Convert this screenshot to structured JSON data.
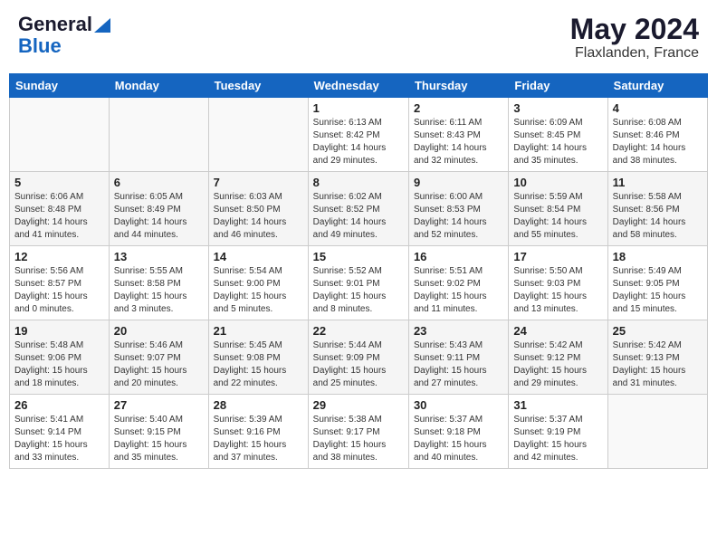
{
  "header": {
    "logo_general": "General",
    "logo_blue": "Blue",
    "month_year": "May 2024",
    "location": "Flaxlanden, France"
  },
  "weekdays": [
    "Sunday",
    "Monday",
    "Tuesday",
    "Wednesday",
    "Thursday",
    "Friday",
    "Saturday"
  ],
  "weeks": [
    [
      {
        "day": "",
        "info": ""
      },
      {
        "day": "",
        "info": ""
      },
      {
        "day": "",
        "info": ""
      },
      {
        "day": "1",
        "info": "Sunrise: 6:13 AM\nSunset: 8:42 PM\nDaylight: 14 hours\nand 29 minutes."
      },
      {
        "day": "2",
        "info": "Sunrise: 6:11 AM\nSunset: 8:43 PM\nDaylight: 14 hours\nand 32 minutes."
      },
      {
        "day": "3",
        "info": "Sunrise: 6:09 AM\nSunset: 8:45 PM\nDaylight: 14 hours\nand 35 minutes."
      },
      {
        "day": "4",
        "info": "Sunrise: 6:08 AM\nSunset: 8:46 PM\nDaylight: 14 hours\nand 38 minutes."
      }
    ],
    [
      {
        "day": "5",
        "info": "Sunrise: 6:06 AM\nSunset: 8:48 PM\nDaylight: 14 hours\nand 41 minutes."
      },
      {
        "day": "6",
        "info": "Sunrise: 6:05 AM\nSunset: 8:49 PM\nDaylight: 14 hours\nand 44 minutes."
      },
      {
        "day": "7",
        "info": "Sunrise: 6:03 AM\nSunset: 8:50 PM\nDaylight: 14 hours\nand 46 minutes."
      },
      {
        "day": "8",
        "info": "Sunrise: 6:02 AM\nSunset: 8:52 PM\nDaylight: 14 hours\nand 49 minutes."
      },
      {
        "day": "9",
        "info": "Sunrise: 6:00 AM\nSunset: 8:53 PM\nDaylight: 14 hours\nand 52 minutes."
      },
      {
        "day": "10",
        "info": "Sunrise: 5:59 AM\nSunset: 8:54 PM\nDaylight: 14 hours\nand 55 minutes."
      },
      {
        "day": "11",
        "info": "Sunrise: 5:58 AM\nSunset: 8:56 PM\nDaylight: 14 hours\nand 58 minutes."
      }
    ],
    [
      {
        "day": "12",
        "info": "Sunrise: 5:56 AM\nSunset: 8:57 PM\nDaylight: 15 hours\nand 0 minutes."
      },
      {
        "day": "13",
        "info": "Sunrise: 5:55 AM\nSunset: 8:58 PM\nDaylight: 15 hours\nand 3 minutes."
      },
      {
        "day": "14",
        "info": "Sunrise: 5:54 AM\nSunset: 9:00 PM\nDaylight: 15 hours\nand 5 minutes."
      },
      {
        "day": "15",
        "info": "Sunrise: 5:52 AM\nSunset: 9:01 PM\nDaylight: 15 hours\nand 8 minutes."
      },
      {
        "day": "16",
        "info": "Sunrise: 5:51 AM\nSunset: 9:02 PM\nDaylight: 15 hours\nand 11 minutes."
      },
      {
        "day": "17",
        "info": "Sunrise: 5:50 AM\nSunset: 9:03 PM\nDaylight: 15 hours\nand 13 minutes."
      },
      {
        "day": "18",
        "info": "Sunrise: 5:49 AM\nSunset: 9:05 PM\nDaylight: 15 hours\nand 15 minutes."
      }
    ],
    [
      {
        "day": "19",
        "info": "Sunrise: 5:48 AM\nSunset: 9:06 PM\nDaylight: 15 hours\nand 18 minutes."
      },
      {
        "day": "20",
        "info": "Sunrise: 5:46 AM\nSunset: 9:07 PM\nDaylight: 15 hours\nand 20 minutes."
      },
      {
        "day": "21",
        "info": "Sunrise: 5:45 AM\nSunset: 9:08 PM\nDaylight: 15 hours\nand 22 minutes."
      },
      {
        "day": "22",
        "info": "Sunrise: 5:44 AM\nSunset: 9:09 PM\nDaylight: 15 hours\nand 25 minutes."
      },
      {
        "day": "23",
        "info": "Sunrise: 5:43 AM\nSunset: 9:11 PM\nDaylight: 15 hours\nand 27 minutes."
      },
      {
        "day": "24",
        "info": "Sunrise: 5:42 AM\nSunset: 9:12 PM\nDaylight: 15 hours\nand 29 minutes."
      },
      {
        "day": "25",
        "info": "Sunrise: 5:42 AM\nSunset: 9:13 PM\nDaylight: 15 hours\nand 31 minutes."
      }
    ],
    [
      {
        "day": "26",
        "info": "Sunrise: 5:41 AM\nSunset: 9:14 PM\nDaylight: 15 hours\nand 33 minutes."
      },
      {
        "day": "27",
        "info": "Sunrise: 5:40 AM\nSunset: 9:15 PM\nDaylight: 15 hours\nand 35 minutes."
      },
      {
        "day": "28",
        "info": "Sunrise: 5:39 AM\nSunset: 9:16 PM\nDaylight: 15 hours\nand 37 minutes."
      },
      {
        "day": "29",
        "info": "Sunrise: 5:38 AM\nSunset: 9:17 PM\nDaylight: 15 hours\nand 38 minutes."
      },
      {
        "day": "30",
        "info": "Sunrise: 5:37 AM\nSunset: 9:18 PM\nDaylight: 15 hours\nand 40 minutes."
      },
      {
        "day": "31",
        "info": "Sunrise: 5:37 AM\nSunset: 9:19 PM\nDaylight: 15 hours\nand 42 minutes."
      },
      {
        "day": "",
        "info": ""
      }
    ]
  ]
}
